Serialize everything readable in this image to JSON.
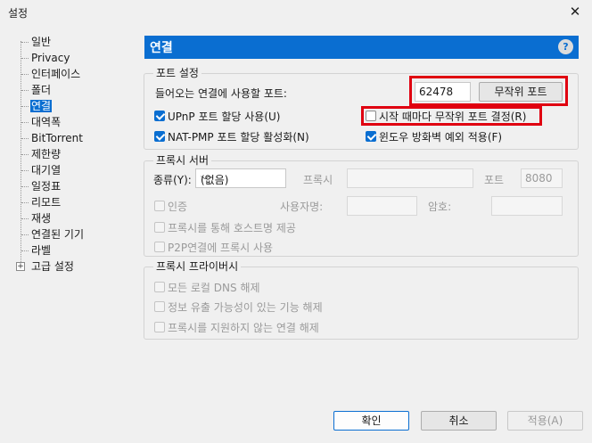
{
  "window": {
    "title": "설정",
    "close_glyph": "✕"
  },
  "tree": {
    "items": [
      {
        "label": "일반"
      },
      {
        "label": "Privacy"
      },
      {
        "label": "인터페이스"
      },
      {
        "label": "폴더"
      },
      {
        "label": "연결",
        "selected": true
      },
      {
        "label": "대역폭"
      },
      {
        "label": "BitTorrent"
      },
      {
        "label": "제한량"
      },
      {
        "label": "대기열"
      },
      {
        "label": "일정표"
      },
      {
        "label": "리모트"
      },
      {
        "label": "재생"
      },
      {
        "label": "연결된 기기"
      },
      {
        "label": "라벨"
      },
      {
        "label": "고급 설정",
        "expander": "+"
      }
    ]
  },
  "header": {
    "title": "연결",
    "help": "?"
  },
  "port": {
    "group_title": "포트 설정",
    "incoming_label": "들어오는 연결에 사용할 포트:",
    "port_value": "62478",
    "random_button": "무작위 포트",
    "upnp_label": "UPnP 포트 할당 사용(U)",
    "upnp_checked": true,
    "random_each_start_label": "시작 때마다 무작위 포트 결정(R)",
    "random_each_start_checked": false,
    "natpmp_label": "NAT-PMP 포트 할당 활성화(N)",
    "natpmp_checked": true,
    "firewall_label": "윈도우 방화벽 예외 적용(F)",
    "firewall_checked": true
  },
  "proxy": {
    "group_title": "프록시 서버",
    "type_label": "종류(Y):",
    "type_value": "(없음)",
    "proxy_label": "프록시",
    "port_label": "포트",
    "port_value": "8080",
    "auth_label": "인증",
    "username_label": "사용자명:",
    "password_label": "암호:",
    "hostname_label": "프록시를 통해 호스트명 제공",
    "p2p_label": "P2P연결에 프록시 사용"
  },
  "privacy": {
    "group_title": "프록시 프라이버시",
    "dns_label": "모든 로컬 DNS 해제",
    "leak_label": "정보 유출 가능성이 있는 기능 해제",
    "unsupported_label": "프록시를 지원하지 않는 연결 해제"
  },
  "buttons": {
    "ok": "확인",
    "cancel": "취소",
    "apply": "적용(A)"
  },
  "colors": {
    "accent": "#0a6ed1",
    "highlight_box": "#e00010"
  }
}
